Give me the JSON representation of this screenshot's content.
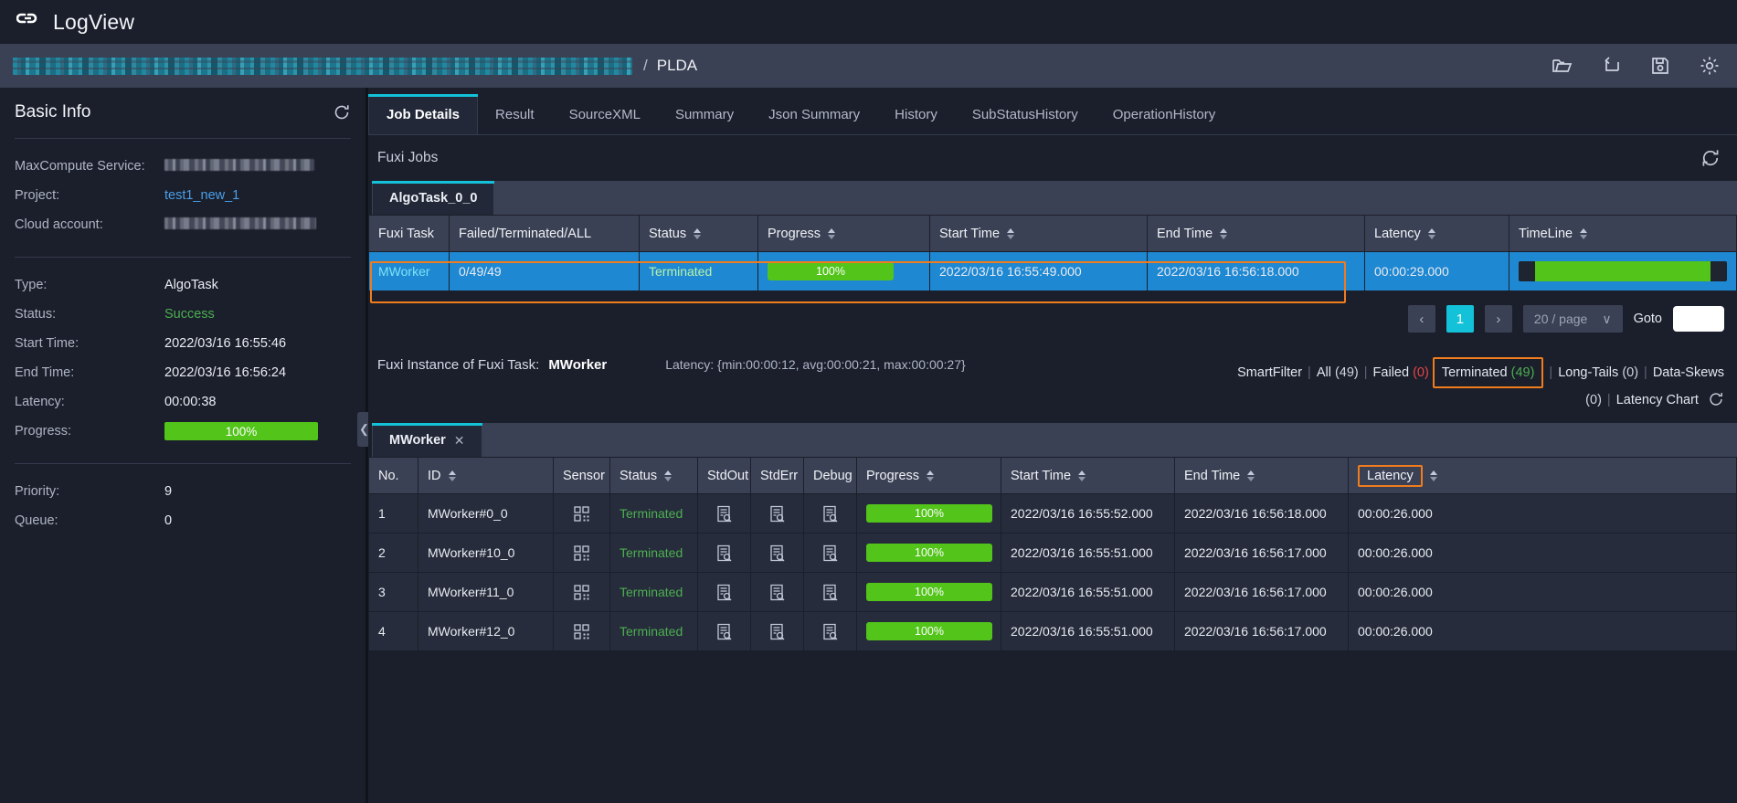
{
  "window": {
    "app_title": "LogView",
    "logo_icon": "code-bracket-icon"
  },
  "breadcrumb": {
    "root_redacted": true,
    "separator": "/",
    "leaf": "PLDA",
    "actions": [
      {
        "name": "open-folder-icon",
        "label": "Open"
      },
      {
        "name": "return-arrow-icon",
        "label": "Back"
      },
      {
        "name": "save-icon",
        "label": "Save"
      },
      {
        "name": "gear-icon",
        "label": "Settings"
      }
    ]
  },
  "sidebar": {
    "title": "Basic Info",
    "refresh_icon": "refresh-icon",
    "group1": [
      {
        "key": "MaxCompute Service:",
        "value": "",
        "redacted": true
      },
      {
        "key": "Project:",
        "value": "test1_new_1",
        "link": true
      },
      {
        "key": "Cloud account:",
        "value": "",
        "redacted": true
      }
    ],
    "group2": [
      {
        "key": "Type:",
        "value": "AlgoTask"
      },
      {
        "key": "Status:",
        "value": "Success",
        "status": "ok"
      },
      {
        "key": "Start Time:",
        "value": "2022/03/16 16:55:46"
      },
      {
        "key": "End Time:",
        "value": "2022/03/16 16:56:24"
      },
      {
        "key": "Latency:",
        "value": "00:00:38"
      },
      {
        "key": "Progress:",
        "value": "100%",
        "progress": 100
      }
    ],
    "group3": [
      {
        "key": "Priority:",
        "value": "9"
      },
      {
        "key": "Queue:",
        "value": "0"
      }
    ]
  },
  "tabs": [
    {
      "label": "Job Details",
      "active": true
    },
    {
      "label": "Result",
      "active": false
    },
    {
      "label": "SourceXML",
      "active": false
    },
    {
      "label": "Summary",
      "active": false
    },
    {
      "label": "Json Summary",
      "active": false
    },
    {
      "label": "History",
      "active": false
    },
    {
      "label": "SubStatusHistory",
      "active": false
    },
    {
      "label": "OperationHistory",
      "active": false
    }
  ],
  "fuxi_jobs": {
    "section_title": "Fuxi Jobs",
    "refresh_icon": "refresh-icon",
    "subtab": "AlgoTask_0_0",
    "columns": [
      {
        "label": "Fuxi Task",
        "sortable": false
      },
      {
        "label": "Failed/Terminated/ALL",
        "sortable": false
      },
      {
        "label": "Status",
        "sortable": true
      },
      {
        "label": "Progress",
        "sortable": true
      },
      {
        "label": "Start Time",
        "sortable": true
      },
      {
        "label": "End Time",
        "sortable": true
      },
      {
        "label": "Latency",
        "sortable": true
      },
      {
        "label": "TimeLine",
        "sortable": true
      }
    ],
    "rows": [
      {
        "task": "MWorker",
        "counts": "0/49/49",
        "status": "Terminated",
        "progress": "100%",
        "start_time": "2022/03/16 16:55:49.000",
        "end_time": "2022/03/16 16:56:18.000",
        "latency": "00:00:29.000",
        "selected": true
      }
    ],
    "pager": {
      "prev": "‹",
      "pages": [
        "1"
      ],
      "current_page": "1",
      "next": "›",
      "page_size": "20 / page",
      "goto_label": "Goto",
      "goto_value": ""
    }
  },
  "fuxi_instance": {
    "prefix": "Fuxi Instance of Fuxi Task:",
    "task_name": "MWorker",
    "latency_summary": "Latency: {min:00:00:12, avg:00:00:21, max:00:00:27}",
    "smart_filter_label": "SmartFilter",
    "filters": [
      {
        "label": "All",
        "count": "(49)",
        "tone": "grey",
        "highlighted": false
      },
      {
        "label": "Failed",
        "count": "(0)",
        "tone": "red",
        "highlighted": false
      },
      {
        "label": "Terminated",
        "count": "(49)",
        "tone": "green",
        "highlighted": true
      },
      {
        "label": "Long-Tails",
        "count": "(0)",
        "tone": "grey",
        "highlighted": false
      },
      {
        "label": "Data-Skews",
        "count": "(0)",
        "tone": "grey",
        "highlighted": false
      }
    ],
    "latency_chart_label": "Latency Chart",
    "latency_chart_icon": "refresh-icon",
    "subtab": "MWorker",
    "subtab_close_icon": "close-icon",
    "columns": [
      {
        "label": "No.",
        "sortable": false
      },
      {
        "label": "ID",
        "sortable": true
      },
      {
        "label": "Sensor",
        "sortable": false
      },
      {
        "label": "Status",
        "sortable": true
      },
      {
        "label": "StdOut",
        "sortable": false
      },
      {
        "label": "StdErr",
        "sortable": false
      },
      {
        "label": "Debug",
        "sortable": false
      },
      {
        "label": "Progress",
        "sortable": true
      },
      {
        "label": "Start Time",
        "sortable": true
      },
      {
        "label": "End Time",
        "sortable": true
      },
      {
        "label": "Latency",
        "sortable": true,
        "highlighted": true
      }
    ],
    "rows": [
      {
        "no": "1",
        "id": "MWorker#0_0",
        "sensor_icon": "qr-code-icon",
        "status": "Terminated",
        "stdout_icon": "log-search-icon",
        "stderr_icon": "log-search-icon",
        "debug_icon": "log-search-icon",
        "progress": "100%",
        "start_time": "2022/03/16 16:55:52.000",
        "end_time": "2022/03/16 16:56:18.000",
        "latency": "00:00:26.000"
      },
      {
        "no": "2",
        "id": "MWorker#10_0",
        "sensor_icon": "qr-code-icon",
        "status": "Terminated",
        "stdout_icon": "log-search-icon",
        "stderr_icon": "log-search-icon",
        "debug_icon": "log-search-icon",
        "progress": "100%",
        "start_time": "2022/03/16 16:55:51.000",
        "end_time": "2022/03/16 16:56:17.000",
        "latency": "00:00:26.000"
      },
      {
        "no": "3",
        "id": "MWorker#11_0",
        "sensor_icon": "qr-code-icon",
        "status": "Terminated",
        "stdout_icon": "log-search-icon",
        "stderr_icon": "log-search-icon",
        "debug_icon": "log-search-icon",
        "progress": "100%",
        "start_time": "2022/03/16 16:55:51.000",
        "end_time": "2022/03/16 16:56:17.000",
        "latency": "00:00:26.000"
      },
      {
        "no": "4",
        "id": "MWorker#12_0",
        "sensor_icon": "qr-code-icon",
        "status": "Terminated",
        "stdout_icon": "log-search-icon",
        "stderr_icon": "log-search-icon",
        "debug_icon": "log-search-icon",
        "progress": "100%",
        "start_time": "2022/03/16 16:55:51.000",
        "end_time": "2022/03/16 16:56:17.000",
        "latency": "00:00:26.000"
      }
    ]
  },
  "colors": {
    "accent_cyan": "#13c2d8",
    "progress_green": "#52c41a",
    "status_green": "#4caf50",
    "error_red": "#e64545",
    "annotation_orange": "#f07c1e",
    "selected_row_blue": "#1e88d2",
    "link_blue": "#4aa8e8"
  },
  "collapse_handle_icon": "chevron-left-icon"
}
